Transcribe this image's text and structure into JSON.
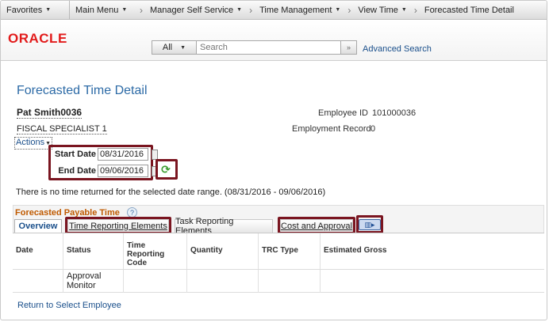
{
  "nav": {
    "favorites": "Favorites",
    "main_menu": "Main Menu",
    "crumbs": [
      "Manager Self Service",
      "Time Management",
      "View Time",
      "Forecasted Time Detail"
    ]
  },
  "brand": {
    "logo": "ORACLE",
    "search_scope": "All",
    "search_placeholder": "Search",
    "advanced_search": "Advanced Search"
  },
  "page": {
    "title": "Forecasted Time Detail",
    "employee_name": "Pat Smith0036",
    "job_title": "FISCAL SPECIALIST 1",
    "actions": "Actions",
    "employee_id_label": "Employee ID",
    "employee_id": "101000036",
    "employment_record_label": "Employment Record",
    "employment_record": "0",
    "start_date_label": "Start Date",
    "start_date": "08/31/2016",
    "end_date_label": "End Date",
    "end_date": "09/06/2016",
    "message": "There is no time returned for the selected date range. (08/31/2016 - 09/06/2016)",
    "return_link": "Return to Select Employee"
  },
  "grid": {
    "title": "Forecasted Payable Time",
    "help": "?",
    "tabs": [
      "Overview",
      "Time Reporting Elements",
      "Task Reporting Elements",
      "Cost and Approval"
    ],
    "columns": [
      "Date",
      "Status",
      "Time Reporting Code",
      "Quantity",
      "TRC Type",
      "Estimated Gross"
    ],
    "row": {
      "status": "Approval Monitor"
    }
  },
  "colors": {
    "highlight": "#7a1520",
    "title_blue": "#2c6aa6",
    "link_blue": "#1a4f8b",
    "grid_title_orange": "#c05a00",
    "oracle_red": "#e21b1b"
  }
}
